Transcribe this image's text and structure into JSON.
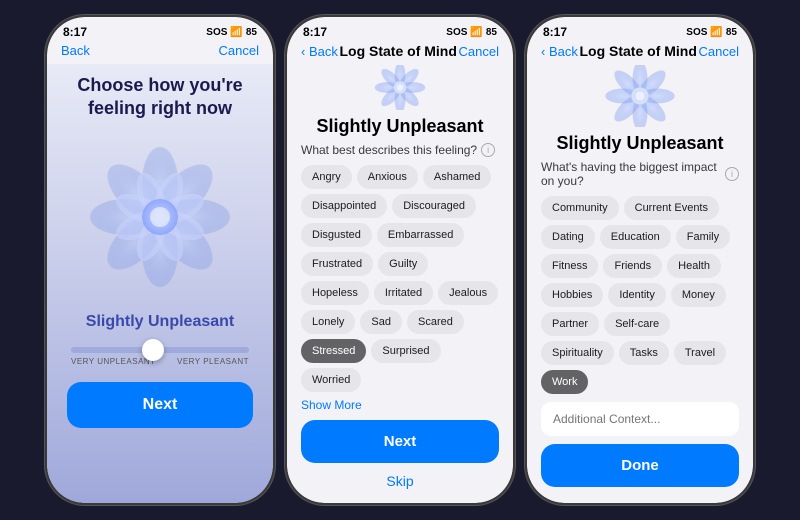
{
  "phones": [
    {
      "id": "phone1",
      "statusBar": {
        "time": "8:17",
        "signal": "SOS",
        "wifi": "WiFi",
        "battery": "85"
      },
      "nav": {
        "back": "Back",
        "title": "",
        "cancel": "Cancel"
      },
      "content": {
        "title": "Choose how you're feeling right now",
        "stateLabel": "Slightly Unpleasant",
        "sliderLabels": {
          "left": "VERY UNPLEASANT",
          "right": "VERY PLEASANT"
        },
        "nextButton": "Next"
      }
    },
    {
      "id": "phone2",
      "statusBar": {
        "time": "8:17",
        "signal": "SOS",
        "wifi": "WiFi",
        "battery": "85"
      },
      "nav": {
        "back": "Back",
        "title": "Log State of Mind",
        "cancel": "Cancel"
      },
      "content": {
        "stateLabel": "Slightly Unpleasant",
        "question": "What best describes this feeling?",
        "tags": [
          {
            "label": "Angry",
            "selected": false
          },
          {
            "label": "Anxious",
            "selected": false
          },
          {
            "label": "Ashamed",
            "selected": false
          },
          {
            "label": "Disappointed",
            "selected": false
          },
          {
            "label": "Discouraged",
            "selected": false
          },
          {
            "label": "Disgusted",
            "selected": false
          },
          {
            "label": "Embarrassed",
            "selected": false
          },
          {
            "label": "Frustrated",
            "selected": false
          },
          {
            "label": "Guilty",
            "selected": false
          },
          {
            "label": "Hopeless",
            "selected": false
          },
          {
            "label": "Irritated",
            "selected": false
          },
          {
            "label": "Jealous",
            "selected": false
          },
          {
            "label": "Lonely",
            "selected": false
          },
          {
            "label": "Sad",
            "selected": false
          },
          {
            "label": "Scared",
            "selected": false
          },
          {
            "label": "Stressed",
            "selected": true
          },
          {
            "label": "Surprised",
            "selected": false
          },
          {
            "label": "Worried",
            "selected": false
          }
        ],
        "showMore": "Show More",
        "nextButton": "Next",
        "skipButton": "Skip"
      }
    },
    {
      "id": "phone3",
      "statusBar": {
        "time": "8:17",
        "signal": "SOS",
        "wifi": "WiFi",
        "battery": "85"
      },
      "nav": {
        "back": "Back",
        "title": "Log State of Mind",
        "cancel": "Cancel"
      },
      "content": {
        "stateLabel": "Slightly Unpleasant",
        "question": "What's having the biggest impact on you?",
        "tags": [
          {
            "label": "Community",
            "selected": false
          },
          {
            "label": "Current Events",
            "selected": false
          },
          {
            "label": "Dating",
            "selected": false
          },
          {
            "label": "Education",
            "selected": false
          },
          {
            "label": "Family",
            "selected": false
          },
          {
            "label": "Fitness",
            "selected": false
          },
          {
            "label": "Friends",
            "selected": false
          },
          {
            "label": "Health",
            "selected": false
          },
          {
            "label": "Hobbies",
            "selected": false
          },
          {
            "label": "Identity",
            "selected": false
          },
          {
            "label": "Money",
            "selected": false
          },
          {
            "label": "Partner",
            "selected": false
          },
          {
            "label": "Self-care",
            "selected": false
          },
          {
            "label": "Spirituality",
            "selected": false
          },
          {
            "label": "Tasks",
            "selected": false
          },
          {
            "label": "Travel",
            "selected": false
          },
          {
            "label": "Work",
            "selected": true
          }
        ],
        "additionalPlaceholder": "Additional Context...",
        "doneButton": "Done"
      }
    }
  ]
}
